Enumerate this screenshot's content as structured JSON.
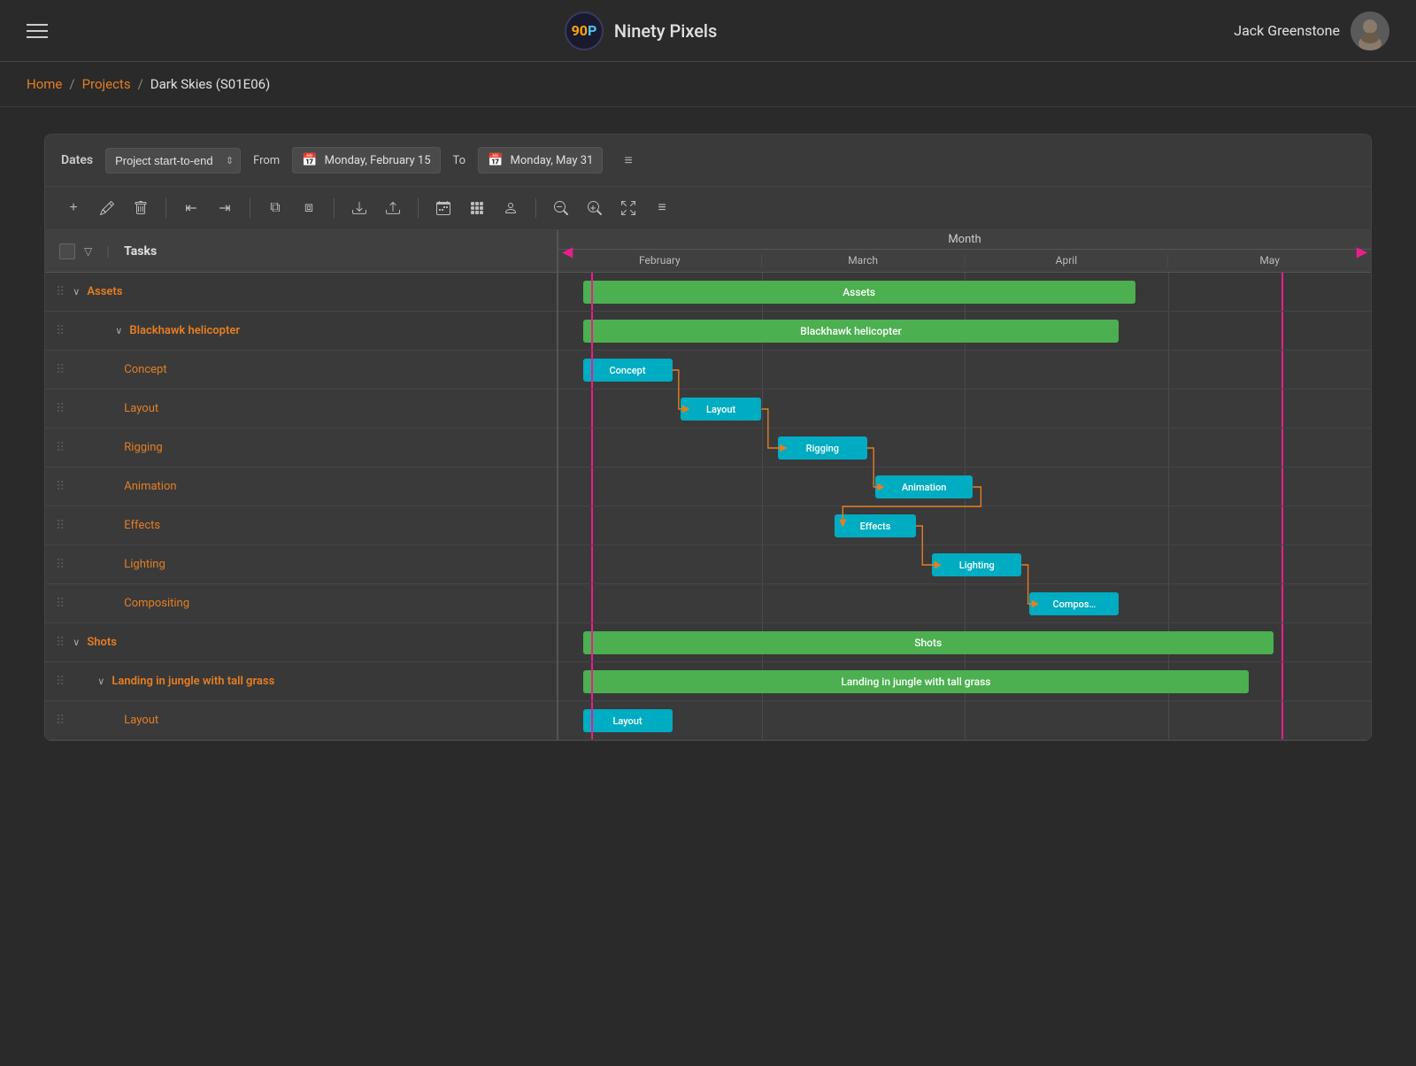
{
  "header": {
    "logo": "90P",
    "logo_ninety": "90",
    "logo_p": "P",
    "app_name": "Ninety Pixels",
    "user_name": "Jack Greenstone",
    "hamburger_label": "menu"
  },
  "breadcrumb": {
    "home": "Home",
    "projects": "Projects",
    "current": "Dark Skies (S01E06)"
  },
  "dates_toolbar": {
    "dates_label": "Dates",
    "select_option": "Project start-to-end",
    "from_label": "From",
    "to_label": "To",
    "from_date": "Monday, February 15",
    "to_date": "Monday, May 31"
  },
  "action_toolbar": {
    "buttons": [
      "+",
      "✎",
      "🗑",
      "|",
      "⇤",
      "⇥",
      "|",
      "⧉",
      "⧈",
      "|",
      "⬇",
      "⬆",
      "⬇",
      "|",
      "📅",
      "📆",
      "👤",
      "|",
      "🔍",
      "🔎",
      "📄",
      "≡"
    ]
  },
  "gantt": {
    "tasks_header_label": "Tasks",
    "month_header": "Month",
    "months": [
      "February",
      "March",
      "April",
      "May"
    ],
    "tasks": [
      {
        "id": 1,
        "indent": 0,
        "expand": true,
        "name": "Assets",
        "type": "parent",
        "bar_type": "green",
        "bar_label": "Assets",
        "bar_left_pct": 2,
        "bar_width_pct": 68
      },
      {
        "id": 2,
        "indent": 1,
        "expand": true,
        "name": "Blackhawk helicopter",
        "type": "parent",
        "bar_type": "green",
        "bar_label": "Blackhawk helicopter",
        "bar_left_pct": 2,
        "bar_width_pct": 66
      },
      {
        "id": 3,
        "indent": 2,
        "expand": false,
        "name": "Concept",
        "type": "task",
        "bar_type": "cyan",
        "bar_label": "Concept",
        "bar_left_pct": 2,
        "bar_width_pct": 10
      },
      {
        "id": 4,
        "indent": 2,
        "expand": false,
        "name": "Layout",
        "type": "task",
        "bar_type": "cyan",
        "bar_label": "Layout",
        "bar_left_pct": 13,
        "bar_width_pct": 10
      },
      {
        "id": 5,
        "indent": 2,
        "expand": false,
        "name": "Rigging",
        "type": "task",
        "bar_type": "cyan",
        "bar_label": "Rigging",
        "bar_left_pct": 24,
        "bar_width_pct": 11
      },
      {
        "id": 6,
        "indent": 2,
        "expand": false,
        "name": "Animation",
        "type": "task",
        "bar_type": "cyan",
        "bar_label": "Animation",
        "bar_left_pct": 36,
        "bar_width_pct": 12
      },
      {
        "id": 7,
        "indent": 2,
        "expand": false,
        "name": "Effects",
        "type": "task",
        "bar_type": "cyan",
        "bar_label": "Effects",
        "bar_left_pct": 33,
        "bar_width_pct": 10
      },
      {
        "id": 8,
        "indent": 2,
        "expand": false,
        "name": "Lighting",
        "type": "task",
        "bar_type": "cyan",
        "bar_label": "Lighting",
        "bar_left_pct": 46,
        "bar_width_pct": 11
      },
      {
        "id": 9,
        "indent": 2,
        "expand": false,
        "name": "Compositing",
        "type": "task",
        "bar_type": "cyan",
        "bar_label": "Compos…",
        "bar_left_pct": 58,
        "bar_width_pct": 10
      },
      {
        "id": 10,
        "indent": 0,
        "expand": true,
        "name": "Shots",
        "type": "parent",
        "bar_type": "green",
        "bar_label": "Shots",
        "bar_left_pct": 2,
        "bar_width_pct": 86
      },
      {
        "id": 11,
        "indent": 1,
        "expand": true,
        "name": "Landing in jungle with tall grass",
        "type": "parent",
        "bar_type": "green",
        "bar_label": "Landing in jungle with tall grass",
        "bar_left_pct": 2,
        "bar_width_pct": 82
      },
      {
        "id": 12,
        "indent": 2,
        "expand": false,
        "name": "Layout",
        "type": "task",
        "bar_type": "cyan",
        "bar_label": "Layout",
        "bar_left_pct": 2,
        "bar_width_pct": 10
      }
    ],
    "pink_marker_left_pct": 4,
    "pink_marker_right_pct": 90
  }
}
